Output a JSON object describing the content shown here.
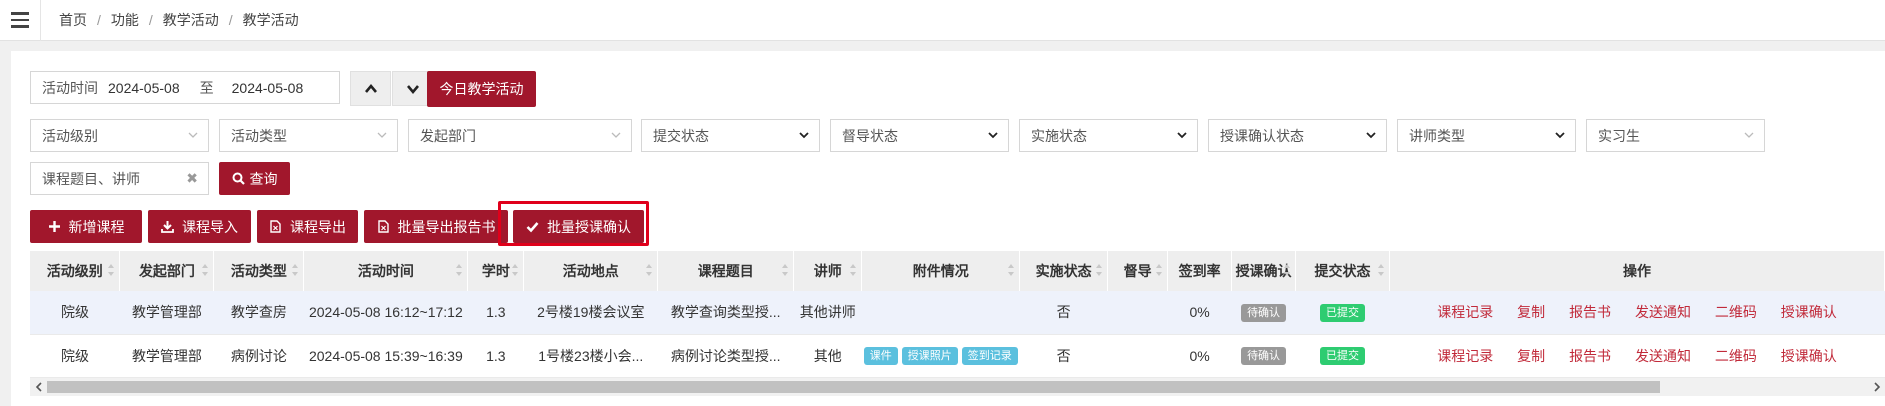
{
  "breadcrumb": [
    "首页",
    "功能",
    "教学活动",
    "教学活动"
  ],
  "filters": {
    "date_label": "活动时间",
    "date_from": "2024-05-08",
    "date_to_label": "至",
    "date_to": "2024-05-08",
    "today_button": "今日教学活动",
    "selects": [
      "活动级别",
      "活动类型",
      "发起部门",
      "提交状态",
      "督导状态",
      "实施状态",
      "授课确认状态",
      "讲师类型",
      "实习生"
    ],
    "search_placeholder": "课程题目、讲师",
    "clear_glyph": "✖",
    "query_button": "查询"
  },
  "actions": [
    "新增课程",
    "课程导入",
    "课程导出",
    "批量导出报告书",
    "批量授课确认"
  ],
  "table": {
    "headers": [
      "活动级别",
      "发起部门",
      "活动类型",
      "活动时间",
      "学时",
      "活动地点",
      "课程题目",
      "讲师",
      "附件情况",
      "实施状态",
      "督导",
      "签到率",
      "授课确认",
      "提交状态",
      "操作"
    ],
    "rows": [
      {
        "level": "院级",
        "dept": "教学管理部",
        "type": "教学查房",
        "time": "2024-05-08 16:12~17:12",
        "hours": "1.3",
        "place": "2号楼19楼会议室",
        "title": "教学查询类型授...",
        "lecturer": "其他讲师",
        "attachments": [],
        "implemented": "否",
        "supervise": "",
        "signin": "0%",
        "confirm": "待确认",
        "submit": "已提交",
        "ops": [
          "课程记录",
          "复制",
          "报告书",
          "发送通知",
          "二维码",
          "授课确认"
        ]
      },
      {
        "level": "院级",
        "dept": "教学管理部",
        "type": "病例讨论",
        "time": "2024-05-08 15:39~16:39",
        "hours": "1.3",
        "place": "1号楼23楼小会...",
        "title": "病例讨论类型授...",
        "lecturer": "其他",
        "attachments": [
          "课件",
          "授课照片",
          "签到记录"
        ],
        "implemented": "否",
        "supervise": "",
        "signin": "0%",
        "confirm": "待确认",
        "submit": "已提交",
        "ops": [
          "课程记录",
          "复制",
          "报告书",
          "发送通知",
          "二维码",
          "授课确认"
        ]
      }
    ]
  },
  "colors": {
    "primary": "#a1172c",
    "link": "#c12a3a",
    "pending": "#999999",
    "submitted": "#2ecc71",
    "attachment": "#5bc0de",
    "highlight": "#e0001b"
  }
}
